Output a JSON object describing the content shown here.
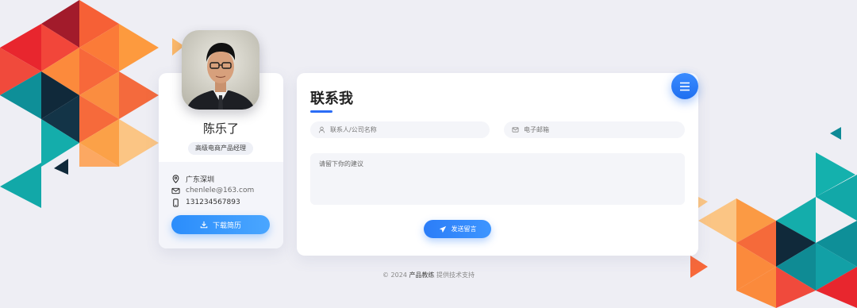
{
  "profile": {
    "name": "陈乐了",
    "title": "高级电商产品经理",
    "location": "广东深圳",
    "email": "chenlele@163.com",
    "phone": "131234567893",
    "download_label": "下载简历"
  },
  "contact": {
    "heading": "联系我",
    "name_placeholder": "联系人/公司名称",
    "email_placeholder": "电子邮箱",
    "message_placeholder": "请留下你的建议",
    "send_label": "发送留言"
  },
  "footer": {
    "prefix": "© 2024",
    "brand": "产品教练",
    "suffix": "提供技术支持"
  },
  "colors": {
    "accent": "#2b7df8",
    "background": "#eeeef4",
    "art_red": "#f0383a",
    "art_orange": "#f98a3a",
    "art_teal": "#12a8a8",
    "art_navy": "#10293a"
  }
}
